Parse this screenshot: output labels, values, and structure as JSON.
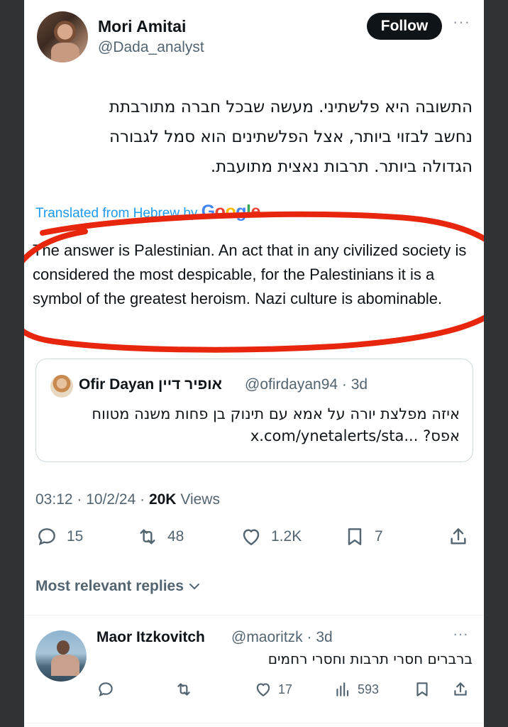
{
  "author": {
    "display_name": "Mori Amitai",
    "handle": "@Dada_analyst",
    "follow_label": "Follow",
    "more_label": "···"
  },
  "tweet": {
    "hebrew_lines": [
      "התשובה היא פלשתיני. מעשה שבכל חברה מתורבתת",
      "נחשב לבזוי ביותר, אצל הפלשתינים הוא סמל לגבורה",
      "הגדולה ביותר. תרבות נאצית מתועבת."
    ],
    "translated_label": "Translated from Hebrew by",
    "google_letters": [
      "G",
      "o",
      "o",
      "g",
      "l",
      "e"
    ],
    "translation": "The answer is Palestinian. An act that in any civilized society is considered the most despicable, for the Palestinians it is a symbol of the greatest heroism. Nazi culture is abominable."
  },
  "quote": {
    "name": "Ofir Dayan אופיר דיין",
    "handle_time": "@ofirdayan94 · 3d",
    "text_line1": "איזה מפלצת יורה על אמא עם תינוק בן פחות משנה מטווח",
    "text_line2_rtl": "אפס?",
    "text_line2_link": "x.com/ynetalerts/sta..."
  },
  "meta": {
    "time_date": "03:12 · 10/2/24 · ",
    "views_count": "20K",
    "views_label": " Views"
  },
  "actions": {
    "replies": "15",
    "reposts": "48",
    "likes": "1.2K",
    "bookmarks": "7"
  },
  "replies_filter": {
    "label": "Most relevant replies"
  },
  "reply": {
    "name": "Maor Itzkovitch",
    "handle_time": "@maoritzk · 3d",
    "more_label": "···",
    "text": "ברברים חסרי תרבות וחסרי רחמים",
    "likes": "17",
    "views": "593"
  },
  "colors": {
    "accent": "#1d9bf0",
    "annotation": "#e8260e",
    "muted": "#536471"
  }
}
